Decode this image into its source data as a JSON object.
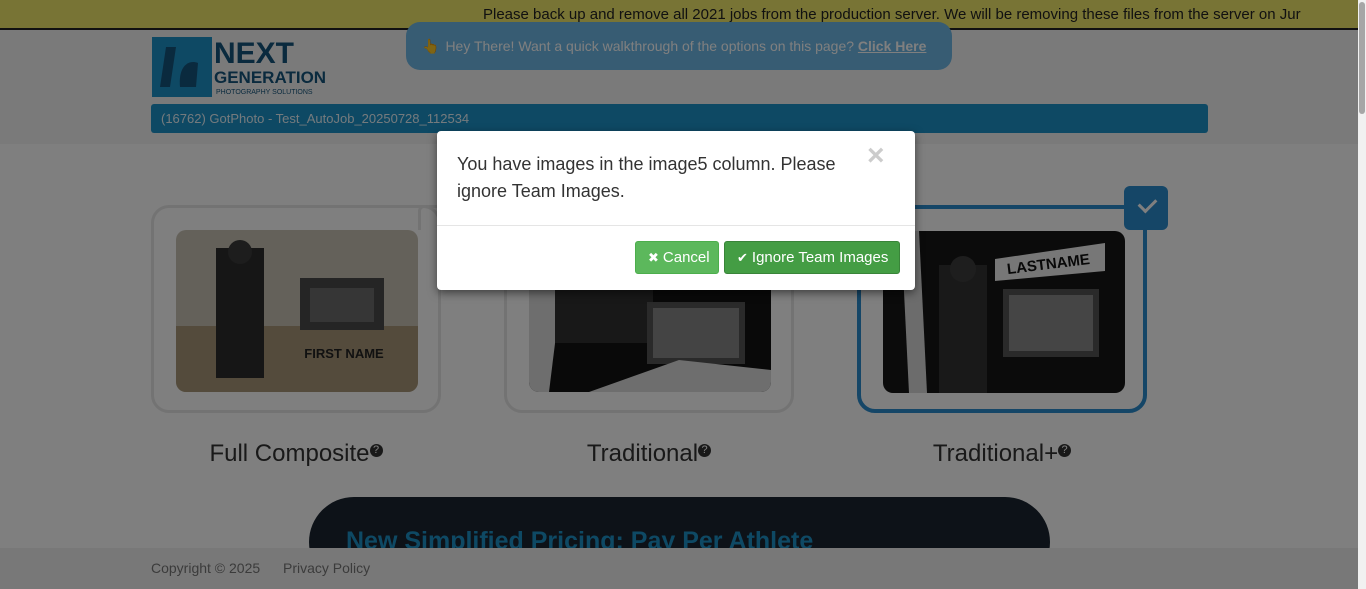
{
  "banner": {
    "message": "Please back up and remove all 2021 jobs from the production server. We will be removing these files from the server on Jur"
  },
  "walkthrough": {
    "text": "Hey There! Want a quick walkthrough of the options on this page?",
    "link": "Click Here"
  },
  "job": {
    "title": "(16762) GotPhoto - Test_AutoJob_20250728_112534"
  },
  "options": [
    {
      "label": "Full Composite",
      "help": "?"
    },
    {
      "label": "Traditional",
      "help": "?"
    },
    {
      "label": "Traditional+",
      "help": "?",
      "selected": true
    }
  ],
  "card_texts": {
    "first_name": "FIRST NAME",
    "lastname": "LASTNAME"
  },
  "pricing": {
    "headline": "New Simplified Pricing: Pay Per Athlete"
  },
  "footer": {
    "copyright": "Copyright © 2025",
    "privacy": "Privacy Policy"
  },
  "modal": {
    "message": "You have images in the image5 column. Please ignore Team Images.",
    "close": "×",
    "cancel_label": "Cancel",
    "ignore_label": "Ignore Team Images",
    "cancel_icon": "✖",
    "ignore_icon": "✔"
  },
  "colors": {
    "accent": "#1d92c9",
    "success": "#5cb85c",
    "banner_bg": "#f1e86b"
  }
}
